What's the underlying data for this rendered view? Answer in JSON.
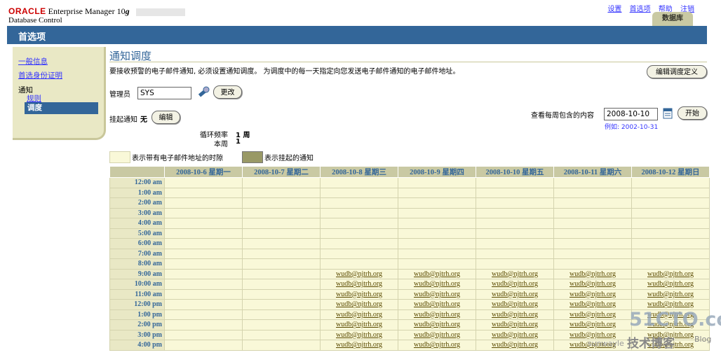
{
  "header": {
    "brand": "ORACLE",
    "product": "Enterprise Manager 10",
    "version": "g",
    "subtitle": "Database Control",
    "links": [
      "设置",
      "首选项",
      "帮助",
      "注销"
    ],
    "tab": "数据库"
  },
  "titlebar": {
    "title": "首选项"
  },
  "sidebar": {
    "items": [
      "一般信息",
      "首选身份证明"
    ],
    "group": "通知",
    "subitems": [
      "规则",
      "调度"
    ]
  },
  "main": {
    "title": "通知调度",
    "description": "要接收预警的电子邮件通知, 必须设置通知调度。 为调度中的每一天指定向您发送电子邮件通知的电子邮件地址。",
    "edit_schedule_button": "编辑调度定义",
    "admin_label": "管理员",
    "admin_value": "SYS",
    "change_button": "更改",
    "suspend_label": "挂起通知",
    "suspend_value": "无",
    "edit_button": "编辑",
    "view_week_label": "查看每周包含的内容",
    "view_week_value": "2008-10-10",
    "example_hint": "例如: 2002-10-31",
    "start_button": "开始",
    "rotation_label": "循环频率",
    "rotation_value": "1 周",
    "this_week_label": "本周",
    "this_week_value": "1",
    "legend_email": "表示带有电子邮件地址的时隙",
    "legend_suspended": "表示挂起的通知"
  },
  "calendar": {
    "days": [
      "2008-10-6 星期一",
      "2008-10-7 星期二",
      "2008-10-8 星期三",
      "2008-10-9 星期四",
      "2008-10-10 星期五",
      "2008-10-11 星期六",
      "2008-10-12 星期日"
    ],
    "times": [
      "12:00 am",
      "1:00 am",
      "2:00 am",
      "3:00 am",
      "4:00 am",
      "5:00 am",
      "6:00 am",
      "7:00 am",
      "8:00 am",
      "9:00 am",
      "10:00 am",
      "11:00 am",
      "12:00 pm",
      "1:00 pm",
      "2:00 pm",
      "3:00 pm",
      "4:00 pm"
    ],
    "email": "wudb@njtrh.org",
    "email_start_row": 9,
    "email_day_indexes": [
      2,
      3,
      4,
      5,
      6
    ]
  },
  "watermark": {
    "site": "51CTO.com",
    "sub": "技术博客",
    "blog": "Blog",
    "author": "sunwayle"
  },
  "colors": {
    "blue": "#336699",
    "tan": "#c9c9a3",
    "slot": "#f9f8d8",
    "suspended": "#999966"
  }
}
